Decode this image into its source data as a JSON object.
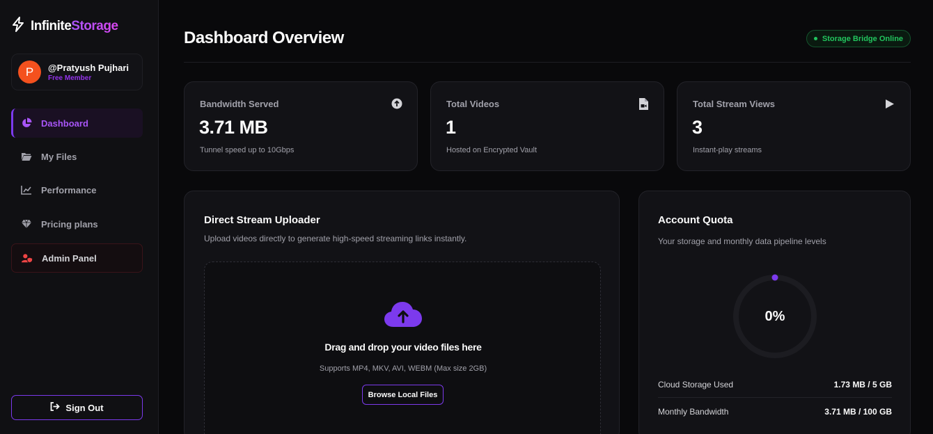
{
  "app": {
    "logo_primary": "Infinite",
    "logo_secondary": "Storage",
    "accent": "#7c3aed",
    "brand_gradient": [
      "#a855f7",
      "#d946ef"
    ]
  },
  "profile": {
    "initial": "P",
    "name": "@Pratyush Pujhari",
    "role": "Free Member",
    "avatar_color": "#f4511e"
  },
  "sidebar": {
    "items": [
      {
        "label": "Dashboard",
        "icon": "pie-chart-icon",
        "active": true
      },
      {
        "label": "My Files",
        "icon": "folder-icon",
        "active": false
      },
      {
        "label": "Performance",
        "icon": "line-chart-icon",
        "active": false
      },
      {
        "label": "Pricing plans",
        "icon": "gem-icon",
        "active": false
      },
      {
        "label": "Admin Panel",
        "icon": "user-shield-icon",
        "active": false
      }
    ],
    "signout_label": "Sign Out"
  },
  "header": {
    "title": "Dashboard Overview",
    "status": "Storage Bridge Online",
    "status_color": "#22c55e"
  },
  "stats": [
    {
      "label": "Bandwidth Served",
      "value": "3.71 MB",
      "sub": "Tunnel speed up to 10Gbps",
      "icon": "arrow-up-circle-icon"
    },
    {
      "label": "Total Videos",
      "value": "1",
      "sub": "Hosted on Encrypted Vault",
      "icon": "file-video-icon"
    },
    {
      "label": "Total Stream Views",
      "value": "3",
      "sub": "Instant-play streams",
      "icon": "play-icon"
    }
  ],
  "uploader": {
    "title": "Direct Stream Uploader",
    "description": "Upload videos directly to generate high-speed streaming links instantly.",
    "drop_title": "Drag and drop your video files here",
    "drop_sub": "Supports MP4, MKV, AVI, WEBM (Max size 2GB)",
    "browse_label": "Browse Local Files"
  },
  "quota": {
    "title": "Account Quota",
    "description": "Your storage and monthly data pipeline levels",
    "percent_label": "0%",
    "percent": 0,
    "rows": [
      {
        "label": "Cloud Storage Used",
        "value": "1.73 MB / 5 GB"
      },
      {
        "label": "Monthly Bandwidth",
        "value": "3.71 MB / 100 GB"
      }
    ]
  }
}
